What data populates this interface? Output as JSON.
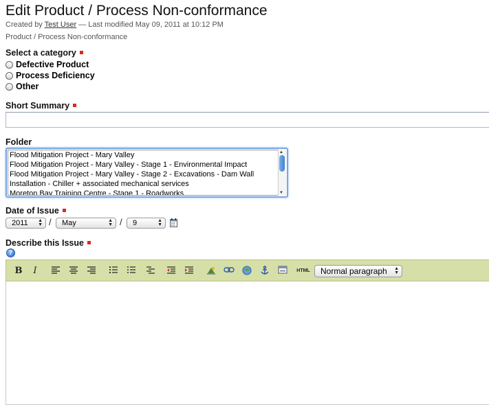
{
  "page": {
    "title": "Edit Product / Process Non-conformance",
    "byline_prefix": "Created by",
    "author": "Test User",
    "byline_suffix": "— Last modified May 09, 2011 at 10:12 PM",
    "breadcrumb": "Product / Process Non-conformance"
  },
  "category": {
    "label": "Select a category",
    "options": [
      "Defective Product",
      "Process Deficiency",
      "Other"
    ]
  },
  "summary": {
    "label": "Short Summary",
    "value": ""
  },
  "folder": {
    "label": "Folder",
    "options": [
      "Flood Mitigation Project - Mary Valley",
      "Flood Mitigation Project - Mary Valley - Stage 1 - Environmental Impact",
      "Flood Mitigation Project - Mary Valley - Stage 2 - Excavations - Dam Wall",
      "Installation - Chiller + associated mechanical services",
      "Moreton Bay Training Centre - Stage 1 - Roadworks"
    ]
  },
  "date": {
    "label": "Date of Issue",
    "year": "2011",
    "month": "May",
    "day": "9",
    "separator": "/"
  },
  "describe": {
    "label": "Describe this Issue",
    "help_glyph": "?"
  },
  "toolbar": {
    "bold": "B",
    "italic": "I",
    "html": "HTML",
    "format_select": "Normal paragraph"
  },
  "icons": {
    "calendar": "calendar-icon",
    "help": "help-icon"
  }
}
